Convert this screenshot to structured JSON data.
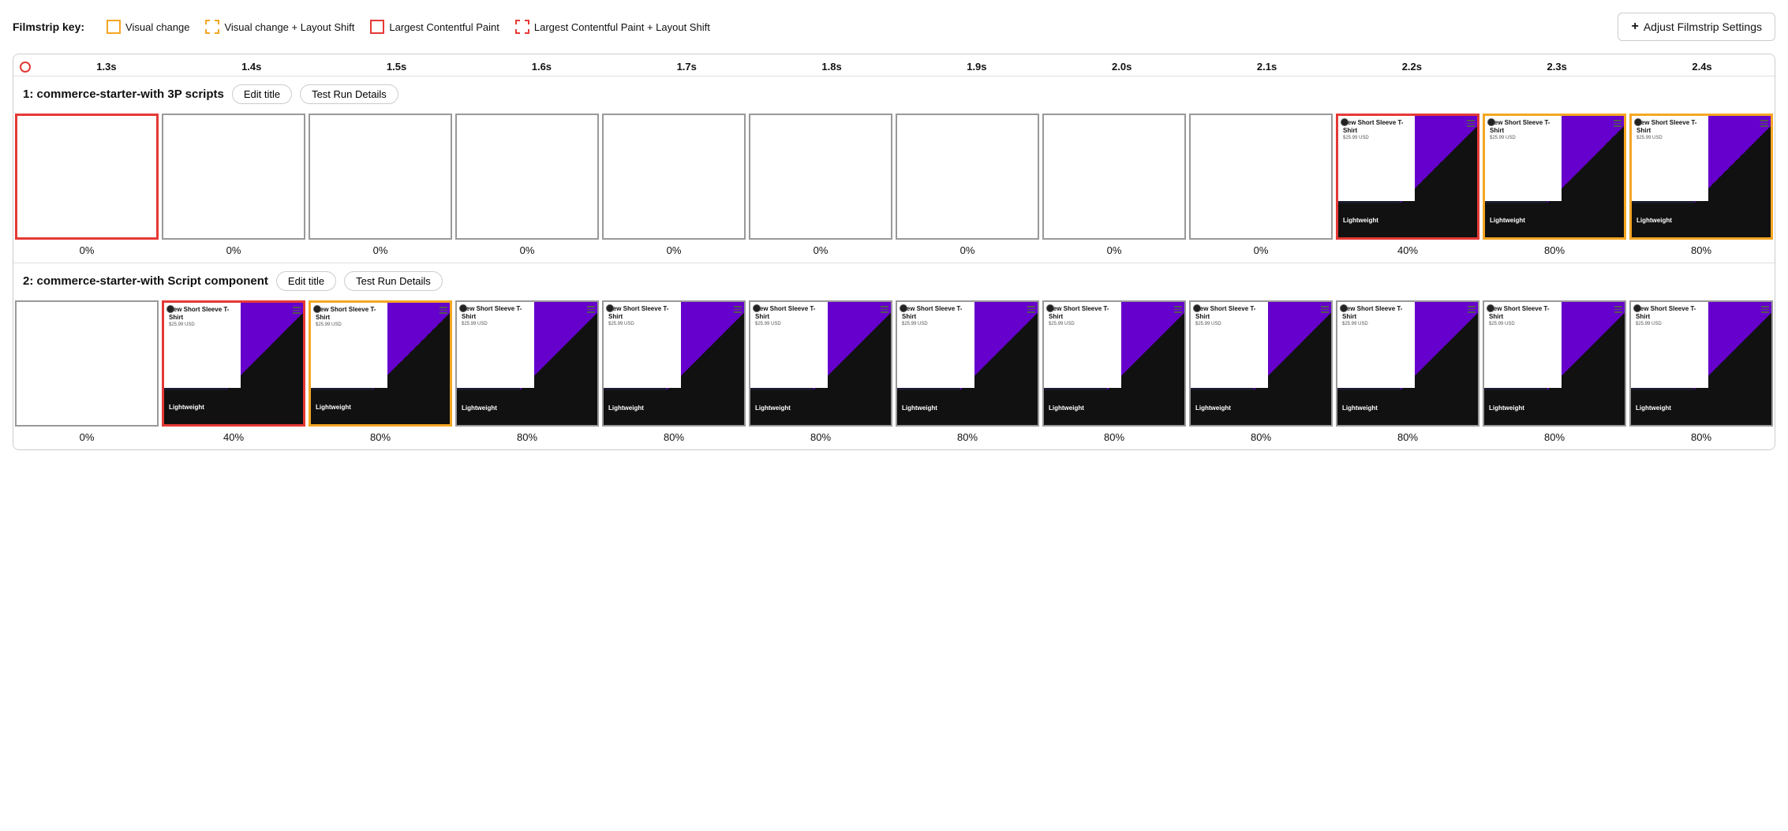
{
  "legend": {
    "key_label": "Filmstrip key:",
    "items": [
      {
        "id": "visual-change",
        "label": "Visual change",
        "border_style": "yellow"
      },
      {
        "id": "visual-change-layout-shift",
        "label": "Visual change + Layout Shift",
        "border_style": "yellow-dashed"
      },
      {
        "id": "lcp",
        "label": "Largest Contentful Paint",
        "border_style": "red"
      },
      {
        "id": "lcp-layout-shift",
        "label": "Largest Contentful Paint + Layout Shift",
        "border_style": "red-dashed"
      }
    ],
    "adjust_button": "Adjust Filmstrip Settings"
  },
  "timeline": {
    "labels": [
      "1.3s",
      "1.4s",
      "1.5s",
      "1.6s",
      "1.7s",
      "1.8s",
      "1.9s",
      "2.0s",
      "2.1s",
      "2.2s",
      "2.3s",
      "2.4s"
    ]
  },
  "sections": [
    {
      "id": "section-1",
      "title": "1: commerce-starter-with 3P scripts",
      "edit_label": "Edit title",
      "details_label": "Test Run Details",
      "frames": [
        {
          "type": "empty",
          "border": "red",
          "pct": "0%"
        },
        {
          "type": "empty",
          "border": "gray",
          "pct": "0%"
        },
        {
          "type": "empty",
          "border": "gray",
          "pct": "0%"
        },
        {
          "type": "empty",
          "border": "gray",
          "pct": "0%"
        },
        {
          "type": "empty",
          "border": "gray",
          "pct": "0%"
        },
        {
          "type": "empty",
          "border": "gray",
          "pct": "0%"
        },
        {
          "type": "empty",
          "border": "gray",
          "pct": "0%"
        },
        {
          "type": "empty",
          "border": "gray",
          "pct": "0%"
        },
        {
          "type": "empty",
          "border": "gray",
          "pct": "0%"
        },
        {
          "type": "screenshot",
          "border": "red",
          "pct": "40%"
        },
        {
          "type": "screenshot",
          "border": "yellow",
          "pct": "80%"
        },
        {
          "type": "screenshot",
          "border": "yellow",
          "pct": "80%"
        }
      ]
    },
    {
      "id": "section-2",
      "title": "2: commerce-starter-with Script component",
      "edit_label": "Edit title",
      "details_label": "Test Run Details",
      "frames": [
        {
          "type": "empty",
          "border": "gray",
          "pct": "0%"
        },
        {
          "type": "screenshot",
          "border": "red",
          "pct": "40%"
        },
        {
          "type": "screenshot",
          "border": "yellow",
          "pct": "80%"
        },
        {
          "type": "screenshot",
          "border": "gray",
          "pct": "80%"
        },
        {
          "type": "screenshot",
          "border": "gray",
          "pct": "80%"
        },
        {
          "type": "screenshot",
          "border": "gray",
          "pct": "80%"
        },
        {
          "type": "screenshot",
          "border": "gray",
          "pct": "80%"
        },
        {
          "type": "screenshot",
          "border": "gray",
          "pct": "80%"
        },
        {
          "type": "screenshot",
          "border": "gray",
          "pct": "80%"
        },
        {
          "type": "screenshot",
          "border": "gray",
          "pct": "80%"
        },
        {
          "type": "screenshot",
          "border": "gray",
          "pct": "80%"
        },
        {
          "type": "screenshot",
          "border": "gray",
          "pct": "80%"
        }
      ]
    }
  ]
}
